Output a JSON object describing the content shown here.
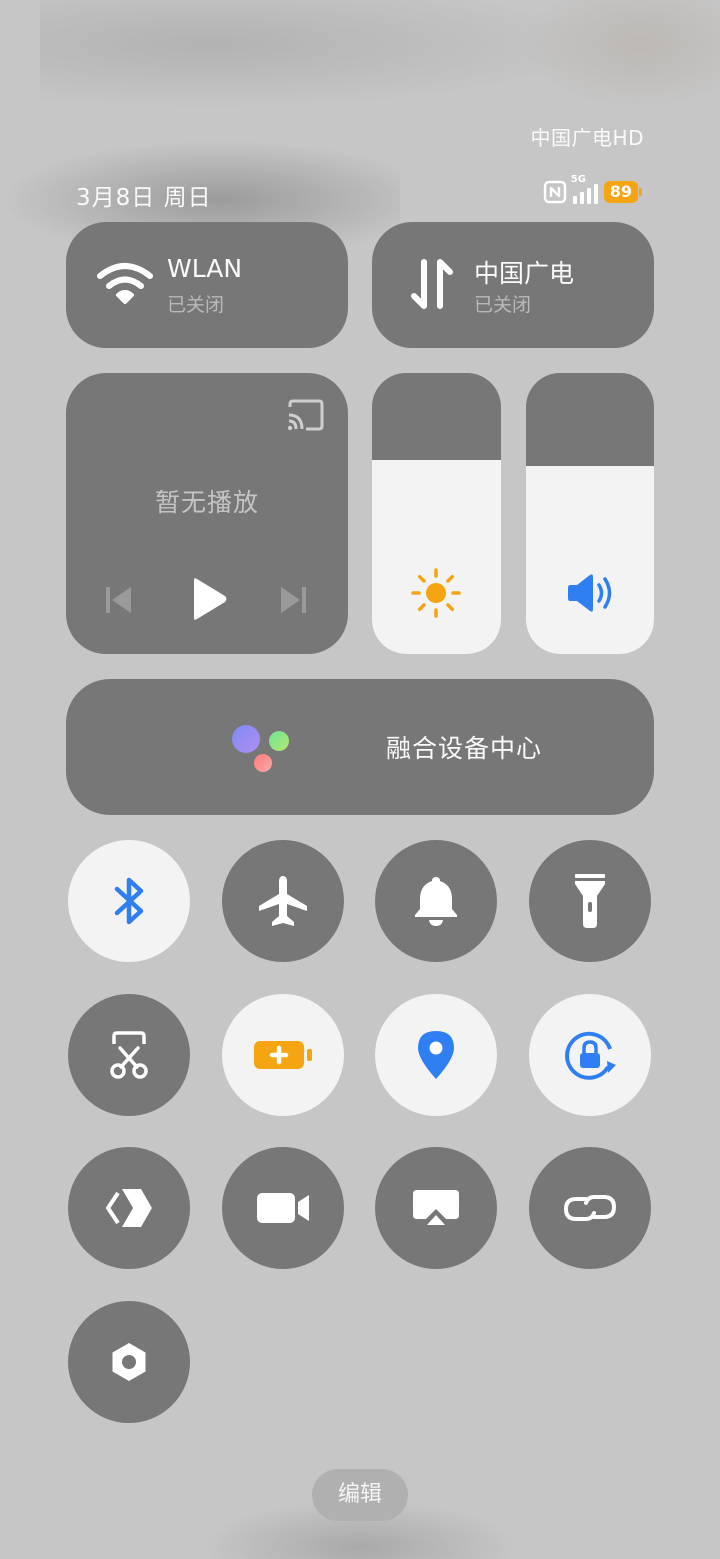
{
  "status_bar": {
    "carrier": "中国广电HD",
    "date": "3月8日 周日",
    "network_type": "5G",
    "battery_level": "89",
    "battery_color": "#f5a511"
  },
  "tiles": {
    "wlan": {
      "title": "WLAN",
      "status": "已关闭",
      "icon": "wifi-icon"
    },
    "cellular": {
      "title": "中国广电",
      "status": "已关闭",
      "icon": "data-arrows-icon"
    }
  },
  "media": {
    "empty_text": "暂无播放",
    "icons": [
      "cast-icon",
      "previous-icon",
      "play-icon",
      "next-icon"
    ]
  },
  "sliders": {
    "brightness": {
      "level": 0.69,
      "icon": "sun-icon",
      "color": "#f5a511"
    },
    "volume": {
      "level": 0.67,
      "icon": "speaker-icon",
      "color": "#2f7ff2"
    }
  },
  "fusion": {
    "label": "融合设备中心"
  },
  "toggles": [
    {
      "name": "bluetooth",
      "icon": "bluetooth-icon",
      "on": true
    },
    {
      "name": "airplane-mode",
      "icon": "airplane-icon",
      "on": false
    },
    {
      "name": "ring-mode",
      "icon": "bell-icon",
      "on": false
    },
    {
      "name": "flashlight",
      "icon": "flashlight-icon",
      "on": false
    },
    {
      "name": "screenshot",
      "icon": "scissors-icon",
      "on": false
    },
    {
      "name": "battery-saver",
      "icon": "battery-plus-icon",
      "on": true
    },
    {
      "name": "location",
      "icon": "location-pin-icon",
      "on": true
    },
    {
      "name": "rotation-lock",
      "icon": "rotation-lock-icon",
      "on": true
    },
    {
      "name": "nearby-share",
      "icon": "share-diamond-icon",
      "on": false
    },
    {
      "name": "screen-record",
      "icon": "video-camera-icon",
      "on": false
    },
    {
      "name": "screen-cast",
      "icon": "screen-cast-icon",
      "on": false
    },
    {
      "name": "link",
      "icon": "link-icon",
      "on": false
    },
    {
      "name": "settings-hex",
      "icon": "hexagon-settings-icon",
      "on": false
    }
  ],
  "edit_button": {
    "label": "编辑"
  },
  "accent_colors": {
    "blue": "#2f7ff2",
    "orange": "#f5a511",
    "tile_gray": "#777777"
  }
}
